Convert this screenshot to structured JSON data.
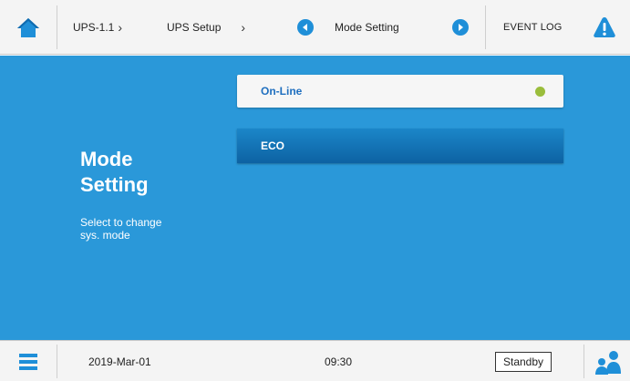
{
  "header": {
    "icons": {
      "home": "home-icon",
      "back": "chevron-left-circle-icon",
      "forward": "chevron-right-circle-icon",
      "alert": "warning-icon"
    },
    "breadcrumb": [
      {
        "label": "UPS-1.1",
        "separator": "›"
      },
      {
        "label": "UPS Setup",
        "separator": "›"
      }
    ],
    "current_page": "Mode Setting",
    "event_log_label": "EVENT LOG"
  },
  "panel": {
    "title_line1": "Mode",
    "title_line2": "Setting",
    "description_line1": "Select to change",
    "description_line2": "sys. mode"
  },
  "modes": [
    {
      "label": "On-Line",
      "selected": true,
      "indicator_color": "#9abd3c"
    },
    {
      "label": "ECO",
      "selected": false
    }
  ],
  "footer": {
    "icons": {
      "menu": "menu-icon",
      "users": "users-icon"
    },
    "date": "2019-Mar-01",
    "time": "09:30",
    "status": "Standby"
  },
  "colors": {
    "accent_blue": "#2a98d9",
    "eco_button": "#0d62a3",
    "link_blue": "#1f6fbf"
  }
}
